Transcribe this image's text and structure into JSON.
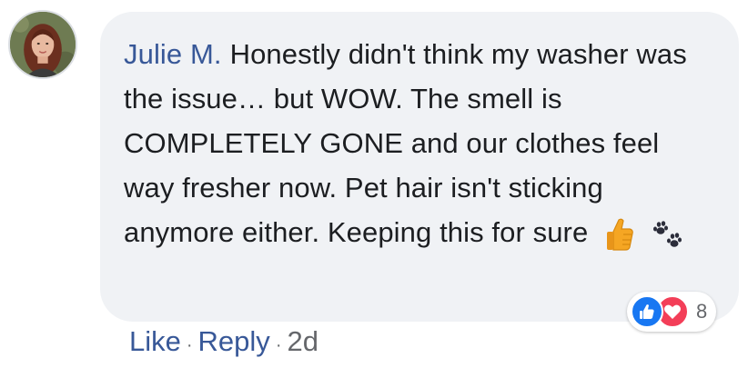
{
  "comment": {
    "author": "Julie M.",
    "text": "Honestly didn't think my washer was the issue… but WOW. The smell is COMPLETELY GONE and our clothes feel way fresher now. Pet hair isn't sticking anymore either. Keeping this for sure",
    "emojis": [
      "thumbs-up-icon",
      "paw-prints-icon"
    ]
  },
  "reactions": {
    "types": [
      "like",
      "love"
    ],
    "count": "8",
    "colors": {
      "like": "#1877f2",
      "love": "#f33e58"
    }
  },
  "actions": {
    "like_label": "Like",
    "reply_label": "Reply",
    "separator": "·",
    "timestamp": "2d"
  },
  "colors": {
    "author": "#385898",
    "bubble": "#f0f2f5",
    "text": "#1c1e21",
    "muted": "#65676b"
  }
}
